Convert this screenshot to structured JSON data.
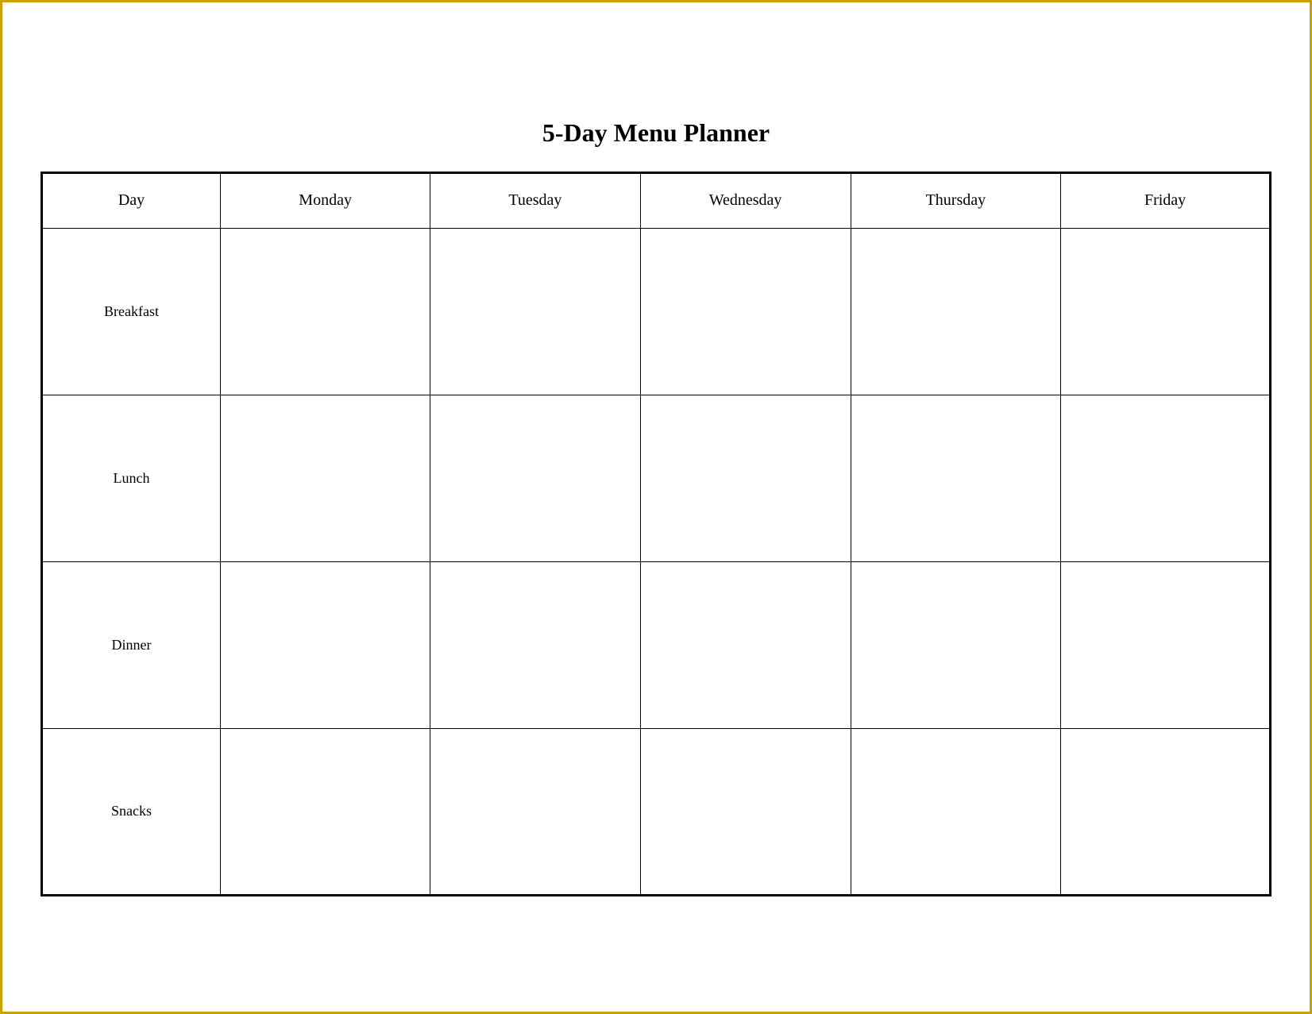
{
  "title": "5-Day Menu Planner",
  "table": {
    "headers": {
      "day": "Day",
      "monday": "Monday",
      "tuesday": "Tuesday",
      "wednesday": "Wednesday",
      "thursday": "Thursday",
      "friday": "Friday"
    },
    "rows": [
      {
        "meal": "Breakfast"
      },
      {
        "meal": "Lunch"
      },
      {
        "meal": "Dinner"
      },
      {
        "meal": "Snacks"
      }
    ]
  }
}
